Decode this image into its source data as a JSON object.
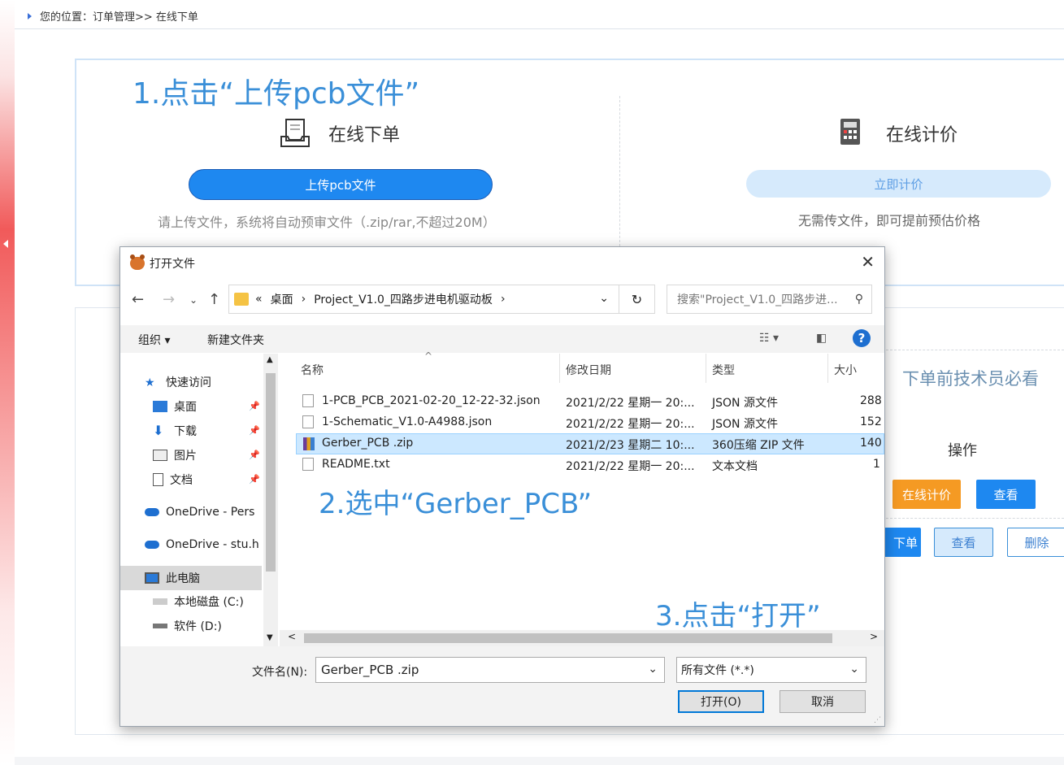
{
  "breadcrumb": {
    "text": "您的位置：订单管理>> 在线下单"
  },
  "order_card": {
    "online_order_title": "在线下单",
    "upload_button": "上传pcb文件",
    "upload_hint": "请上传文件，系统将自动预审文件（.zip/rar,不超过20M）",
    "online_quote_title": "在线计价",
    "quote_button": "立即计价",
    "quote_hint": "无需传文件，即可提前预估价格"
  },
  "background_panel": {
    "notice_title": "下单前技术员必看",
    "operations_header": "操作",
    "quote_button": "在线计价",
    "view_button": "查看",
    "order_button": "下单",
    "view_button_2": "查看",
    "delete_button": "删除"
  },
  "annotations": {
    "step1": "1.点击“上传pcb文件”",
    "step2": "2.选中“Gerber_PCB”",
    "step3": "3.点击“打开”"
  },
  "dialog": {
    "title": "打开文件",
    "address": {
      "prefix": "«",
      "segment1": "桌面",
      "sep": "›",
      "segment2": "Project_V1.0_四路步进电机驱动板",
      "sep2": "›"
    },
    "search_placeholder": "搜索\"Project_V1.0_四路步进...",
    "organize": "组织 ▾",
    "new_folder": "新建文件夹",
    "nav_items": [
      {
        "label": "快速访问"
      },
      {
        "label": "桌面"
      },
      {
        "label": "下载"
      },
      {
        "label": "图片"
      },
      {
        "label": "文档"
      },
      {
        "label": "OneDrive - Pers"
      },
      {
        "label": "OneDrive - stu.h"
      },
      {
        "label": "此电脑"
      },
      {
        "label": "本地磁盘 (C:)"
      },
      {
        "label": "软件 (D:)"
      }
    ],
    "columns": {
      "name": "名称",
      "date": "修改日期",
      "type": "类型",
      "size": "大小"
    },
    "files": [
      {
        "name": "1-PCB_PCB_2021-02-20_12-22-32.json",
        "date": "2021/2/22 星期一 20:...",
        "type": "JSON 源文件",
        "size": "288"
      },
      {
        "name": "1-Schematic_V1.0-A4988.json",
        "date": "2021/2/22 星期一 20:...",
        "type": "JSON 源文件",
        "size": "152"
      },
      {
        "name": "Gerber_PCB .zip",
        "date": "2021/2/23 星期二 10:...",
        "type": "360压缩 ZIP 文件",
        "size": "140"
      },
      {
        "name": "README.txt",
        "date": "2021/2/22 星期一 20:...",
        "type": "文本文档",
        "size": "1"
      }
    ],
    "filename_label": "文件名(N):",
    "filename_value": "Gerber_PCB .zip",
    "filetype_value": "所有文件 (*.*)",
    "open_button": "打开(O)",
    "cancel_button": "取消"
  }
}
